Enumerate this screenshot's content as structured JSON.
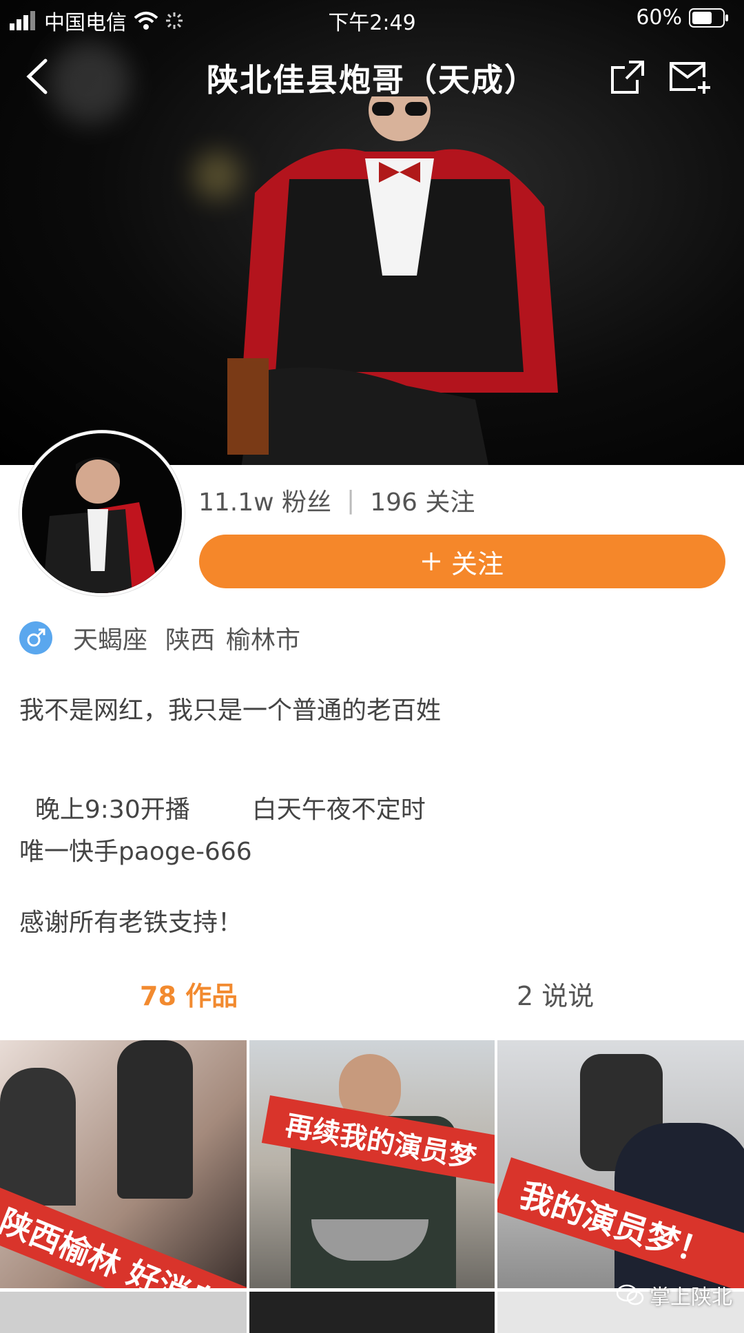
{
  "status_bar": {
    "carrier": "中国电信",
    "time": "下午2:49",
    "battery": "60%"
  },
  "nav": {
    "title": "陕北佳县炮哥（天成）",
    "back_icon": "chevron-left-icon",
    "share_icon": "share-icon",
    "message_icon": "mail-add-icon"
  },
  "profile": {
    "followers": "11.1w 粉丝",
    "following": "196 关注",
    "follow_button": "关注",
    "constellation": "天蝎座",
    "province": "陕西",
    "city": "榆林市"
  },
  "bio": {
    "line1": "我不是网红，我只是一个普通的老百姓",
    "line2a": "晚上9:30开播",
    "line2b": "白天午夜不定时",
    "line3": "唯一快手paoge-666",
    "line4": "感谢所有老铁支持！"
  },
  "tabs": {
    "works": "78 作品",
    "posts": "2 说说"
  },
  "thumbnails": [
    {
      "caption": "陕西榆林  好消息"
    },
    {
      "caption": "再续我的演员梦"
    },
    {
      "caption": "我的演员梦！"
    }
  ],
  "watermark": "掌上陕北",
  "colors": {
    "accent": "#f5872a",
    "tab_active": "#f28a2f",
    "gender_badge": "#5aa7ee"
  }
}
